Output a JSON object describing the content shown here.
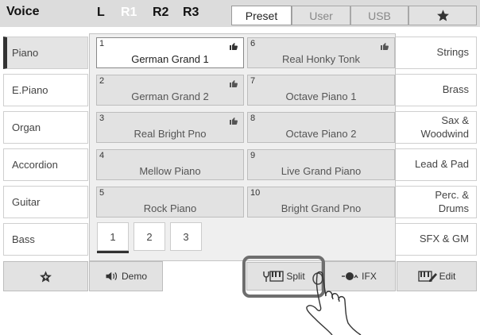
{
  "header": {
    "title": "Voice",
    "layers": [
      "L",
      "R1",
      "R2",
      "R3"
    ],
    "active_layer": "R1",
    "tabs": [
      "Preset",
      "User",
      "USB"
    ],
    "active_tab": "Preset",
    "favorite_icon": "star-icon"
  },
  "categories_left": [
    "Piano",
    "E.Piano",
    "Organ",
    "Accordion",
    "Guitar",
    "Bass"
  ],
  "categories_right": [
    "Strings",
    "Brass",
    "Sax &\nWoodwind",
    "Lead & Pad",
    "Perc. &\nDrums",
    "SFX & GM"
  ],
  "active_category": "Piano",
  "voices": [
    {
      "num": "1",
      "name": "German Grand 1",
      "liked": true,
      "selected": true
    },
    {
      "num": "2",
      "name": "German Grand 2",
      "liked": true
    },
    {
      "num": "3",
      "name": "Real Bright Pno",
      "liked": true
    },
    {
      "num": "4",
      "name": "Mellow Piano",
      "liked": false
    },
    {
      "num": "5",
      "name": "Rock Piano",
      "liked": false
    },
    {
      "num": "6",
      "name": "Real Honky Tonk",
      "liked": true
    },
    {
      "num": "7",
      "name": "Octave Piano 1",
      "liked": false
    },
    {
      "num": "8",
      "name": "Octave Piano 2",
      "liked": false
    },
    {
      "num": "9",
      "name": "Live Grand Piano",
      "liked": false
    },
    {
      "num": "10",
      "name": "Bright Grand Pno",
      "liked": false
    }
  ],
  "pages": [
    "1",
    "2",
    "3"
  ],
  "current_page": "1",
  "toolbar": {
    "demo_label": "Demo",
    "split_label": "Split",
    "ifx_label": "IFX",
    "edit_label": "Edit"
  },
  "colors": {
    "header_bg": "#dcdcdc",
    "button_bg": "#e2e2e2",
    "selected_bg": "#ffffff",
    "highlight_border": "#6e6e6e"
  }
}
